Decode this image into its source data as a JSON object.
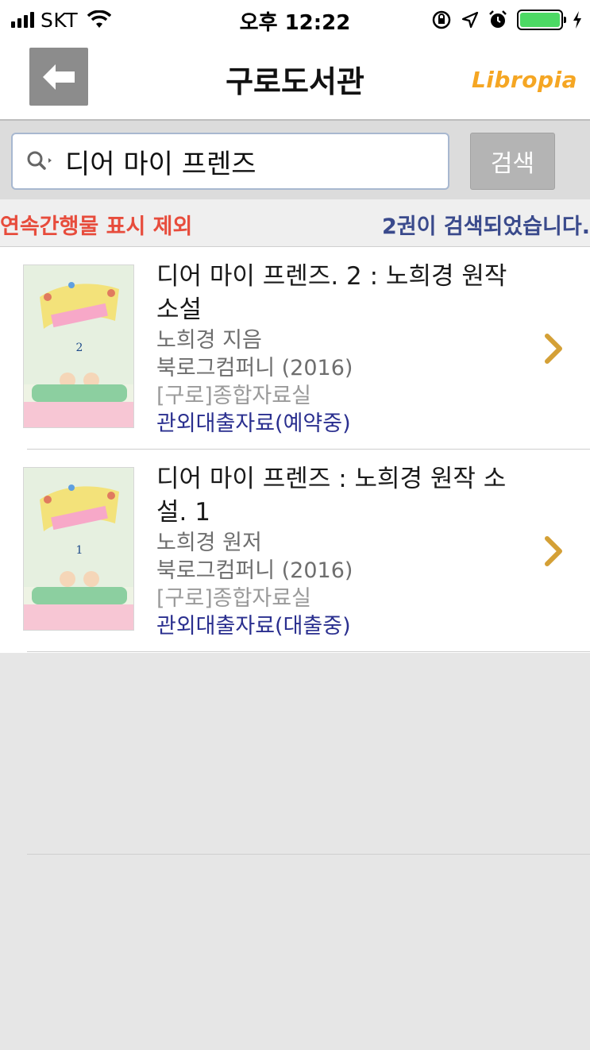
{
  "status_bar": {
    "carrier": "SKT",
    "time": "오후 12:22"
  },
  "header": {
    "title": "구로도서관",
    "logo": "Libropia"
  },
  "search": {
    "query": "디어 마이 프렌즈",
    "button_label": "검색"
  },
  "info": {
    "exclude_label": "연속간행물 표시 제외",
    "result_count": "2권이 검색되었습니다."
  },
  "results": [
    {
      "title": "디어 마이 프렌즈. 2 : 노희경 원작 소설",
      "author": "노희경 지음",
      "publisher": "북로그컴퍼니 (2016)",
      "location": "[구로]종합자료실",
      "status": "관외대출자료(예약중)",
      "volume": "2"
    },
    {
      "title": "디어 마이 프렌즈 : 노희경 원작 소설. 1",
      "author": "노희경 원저",
      "publisher": "북로그컴퍼니 (2016)",
      "location": "[구로]종합자료실",
      "status": "관외대출자료(대출중)",
      "volume": "1"
    }
  ],
  "colors": {
    "accent_orange": "#f5a623",
    "status_blue": "#2a2f8f",
    "exclude_red": "#e74c3c"
  }
}
